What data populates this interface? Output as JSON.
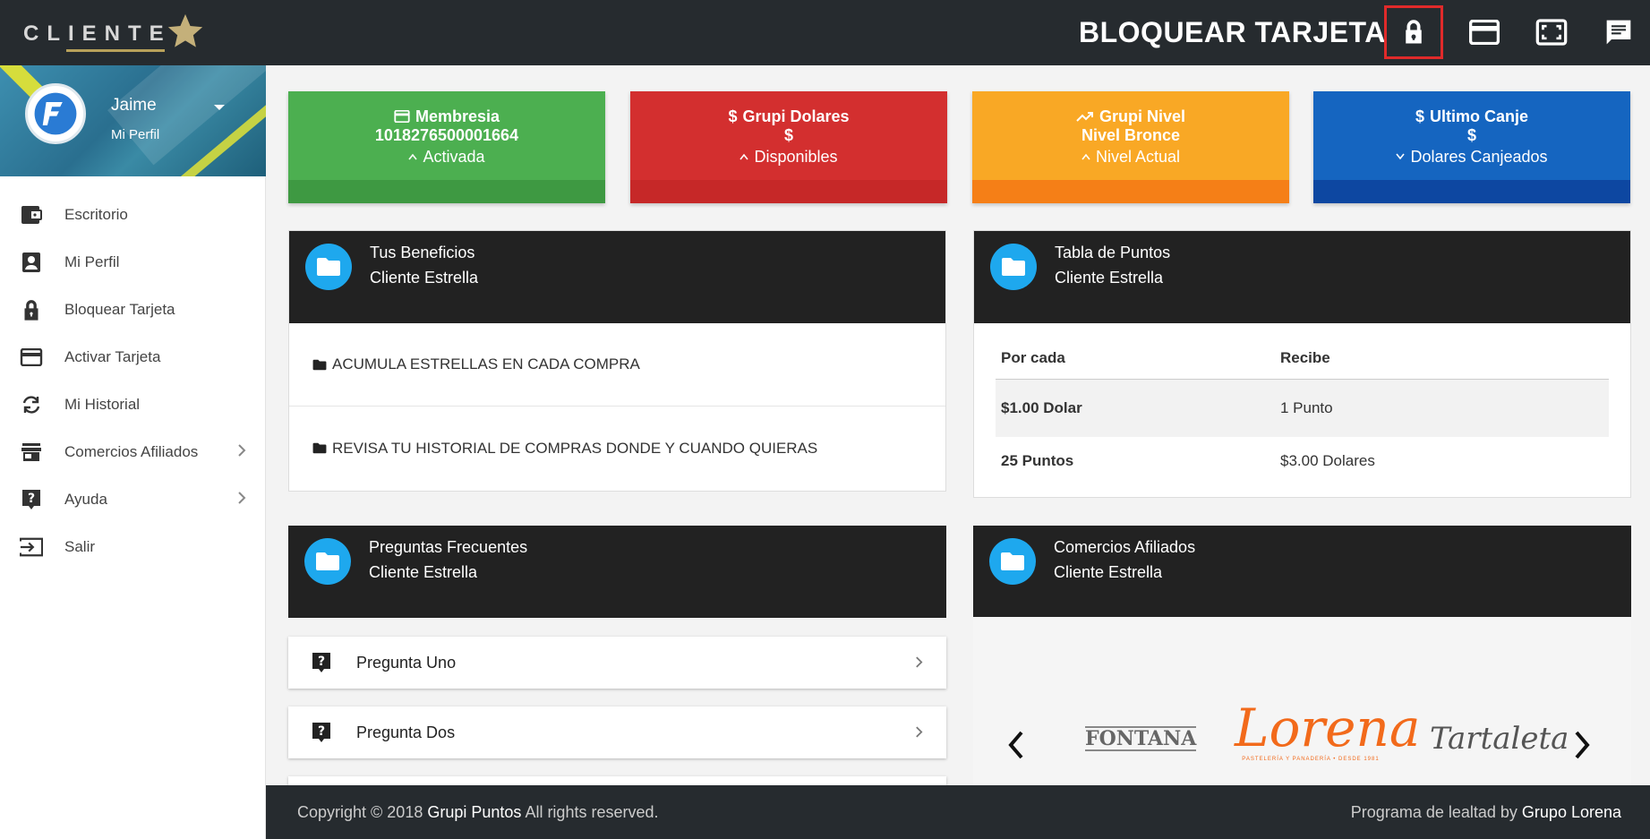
{
  "header": {
    "logo_text": "CLIENTE",
    "title": "BLOQUEAR TARJETA",
    "icons": [
      "lock-icon",
      "credit-card-icon",
      "fullscreen-icon",
      "chat-icon"
    ]
  },
  "sidebar": {
    "user_name": "Jaime",
    "user_sub": "Mi Perfil",
    "items": [
      {
        "label": "Escritorio",
        "icon": "wallet-icon"
      },
      {
        "label": "Mi Perfil",
        "icon": "user-card-icon"
      },
      {
        "label": "Bloquear Tarjeta",
        "icon": "lock-icon"
      },
      {
        "label": "Activar Tarjeta",
        "icon": "credit-card-icon"
      },
      {
        "label": "Mi Historial",
        "icon": "history-icon"
      },
      {
        "label": "Comercios Afiliados",
        "icon": "store-icon"
      },
      {
        "label": "Ayuda",
        "icon": "help-icon"
      },
      {
        "label": "Salir",
        "icon": "exit-icon"
      }
    ]
  },
  "cards": [
    {
      "title": "Membresia",
      "value": "1018276500001664",
      "status": "Activada",
      "color": "#4caf50",
      "foot": "#3e9942"
    },
    {
      "title": "Grupi Dolares",
      "value": "$",
      "status": "Disponibles",
      "color": "#d32f2f",
      "foot": "#c62828"
    },
    {
      "title": "Grupi Nivel",
      "value": "Nivel Bronce",
      "status": "Nivel Actual",
      "color": "#f9a825",
      "foot": "#f57f17"
    },
    {
      "title": "Ultimo Canje",
      "value": "$",
      "status": "Dolares Canjeados",
      "color": "#1565c0",
      "foot": "#0d47a1"
    }
  ],
  "benefits": {
    "title": "Tus Beneficios",
    "subtitle": "Cliente Estrella",
    "items": [
      "ACUMULA ESTRELLAS EN CADA COMPRA",
      "REVISA TU HISTORIAL DE COMPRAS DONDE Y CUANDO QUIERAS"
    ]
  },
  "points": {
    "title": "Tabla de Puntos",
    "subtitle": "Cliente Estrella",
    "col1": "Por cada",
    "col2": "Recibe",
    "rows": [
      {
        "a": "$1.00 Dolar",
        "b": "1 Punto"
      },
      {
        "a": "25 Puntos",
        "b": "$3.00 Dolares"
      }
    ]
  },
  "faq": {
    "title": "Preguntas Frecuentes",
    "subtitle": "Cliente Estrella",
    "items": [
      "Pregunta Uno",
      "Pregunta Dos"
    ]
  },
  "affiliates": {
    "title": "Comercios Afiliados",
    "subtitle": "Cliente Estrella",
    "brands": [
      "FONTANA",
      "Lorena",
      "PASTELERÍA Y PANADERÍA • DESDE 1981",
      "Tartaleta"
    ]
  },
  "footer": {
    "copyright_prefix": "Copyright © 2018",
    "brand": "Grupi Puntos",
    "rights": "All rights reserved.",
    "right_prefix": "Programa de lealtad by",
    "right_brand": "Grupo Lorena"
  }
}
